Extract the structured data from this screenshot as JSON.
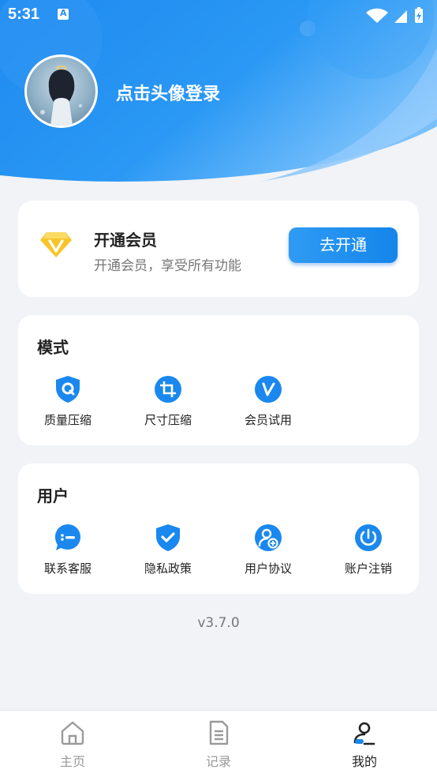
{
  "status_bar": {
    "time": "5:31",
    "notification_letter": "A"
  },
  "profile": {
    "login_prompt": "点击头像登录"
  },
  "vip": {
    "title": "开通会员",
    "subtitle": "开通会员，享受所有功能",
    "button_label": "去开通"
  },
  "mode_section": {
    "title": "模式",
    "items": [
      {
        "label": "质量压缩",
        "icon": "shield-q-icon"
      },
      {
        "label": "尺寸压缩",
        "icon": "crop-icon"
      },
      {
        "label": "会员试用",
        "icon": "vip-v-icon"
      }
    ]
  },
  "user_section": {
    "title": "用户",
    "items": [
      {
        "label": "联系客服",
        "icon": "chat-icon"
      },
      {
        "label": "隐私政策",
        "icon": "shield-check-icon"
      },
      {
        "label": "用户协议",
        "icon": "user-agreement-icon"
      },
      {
        "label": "账户注销",
        "icon": "power-icon"
      }
    ]
  },
  "version": "v3.7.0",
  "tabs": [
    {
      "label": "主页",
      "icon": "home-icon",
      "active": false
    },
    {
      "label": "记录",
      "icon": "document-icon",
      "active": false
    },
    {
      "label": "我的",
      "icon": "profile-icon",
      "active": true
    }
  ],
  "colors": {
    "accent": "#1a88ee",
    "background": "#f1f3f7",
    "muted_text": "#777777",
    "inactive_tab": "#999999"
  }
}
